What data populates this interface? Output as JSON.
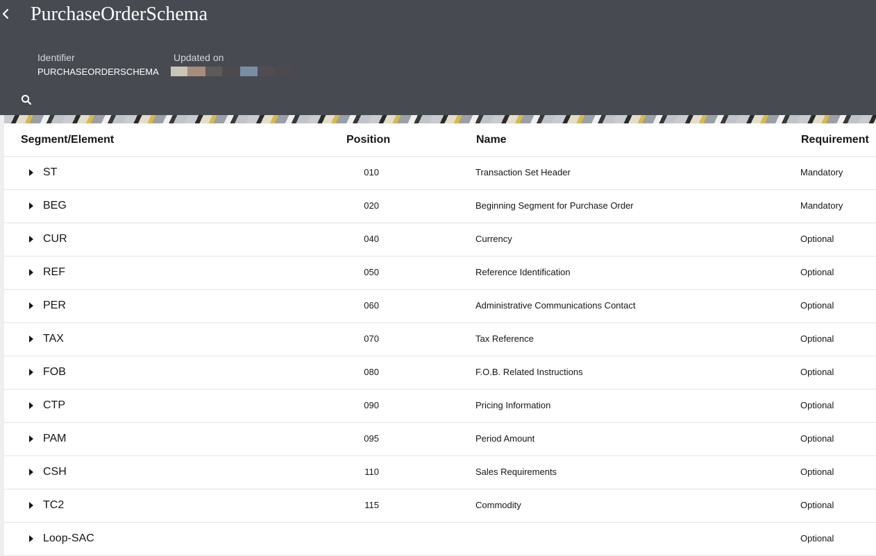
{
  "header": {
    "title": "PurchaseOrderSchema",
    "identifier_label": "Identifier",
    "identifier_value": "PURCHASEORDERSCHEMA",
    "updated_label": "Updated on",
    "back_icon": "chevron-left-icon",
    "search_icon": "search-icon"
  },
  "colors": {
    "header_bg": "#474a51",
    "table_bg": "#ffffff",
    "row_border": "#e3e3e3"
  },
  "table": {
    "columns": {
      "segment": "Segment/Element",
      "position": "Position",
      "name": "Name",
      "requirement": "Requirement"
    },
    "rows": [
      {
        "segment": "ST",
        "position": "010",
        "name": "Transaction Set Header",
        "requirement": "Mandatory"
      },
      {
        "segment": "BEG",
        "position": "020",
        "name": "Beginning Segment for Purchase Order",
        "requirement": "Mandatory"
      },
      {
        "segment": "CUR",
        "position": "040",
        "name": "Currency",
        "requirement": "Optional"
      },
      {
        "segment": "REF",
        "position": "050",
        "name": "Reference Identification",
        "requirement": "Optional"
      },
      {
        "segment": "PER",
        "position": "060",
        "name": "Administrative Communications Contact",
        "requirement": "Optional"
      },
      {
        "segment": "TAX",
        "position": "070",
        "name": "Tax Reference",
        "requirement": "Optional"
      },
      {
        "segment": "FOB",
        "position": "080",
        "name": "F.O.B. Related Instructions",
        "requirement": "Optional"
      },
      {
        "segment": "CTP",
        "position": "090",
        "name": "Pricing Information",
        "requirement": "Optional"
      },
      {
        "segment": "PAM",
        "position": "095",
        "name": "Period Amount",
        "requirement": "Optional"
      },
      {
        "segment": "CSH",
        "position": "110",
        "name": "Sales Requirements",
        "requirement": "Optional"
      },
      {
        "segment": "TC2",
        "position": "115",
        "name": "Commodity",
        "requirement": "Optional"
      },
      {
        "segment": "Loop-SAC",
        "position": "",
        "name": "",
        "requirement": "Optional"
      }
    ]
  }
}
